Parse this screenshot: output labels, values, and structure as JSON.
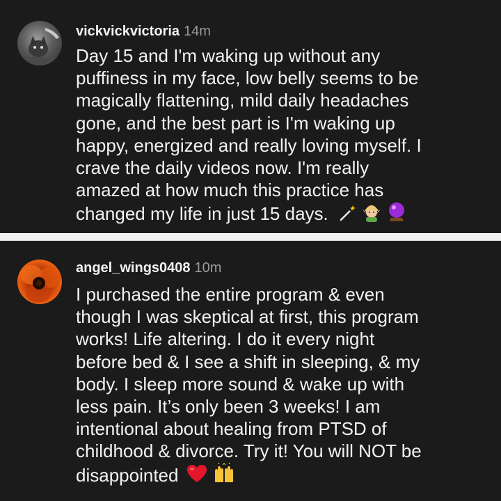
{
  "comments": [
    {
      "username": "vickvickvictoria",
      "time": "14m",
      "lines": [
        "Day 15 and I'm waking up without any",
        "puffiness in my face, low belly seems to be",
        "magically flattening, mild daily headaches",
        "gone, and the best part is I'm waking up",
        "happy, energized and really loving myself. I",
        "crave the daily videos now. I'm really",
        "amazed at how much this practice has",
        "changed my life in just 15 days."
      ],
      "emoji_icons": [
        "magic-wand-icon",
        "elf-icon",
        "crystal-ball-icon"
      ]
    },
    {
      "username": "angel_wings0408",
      "time": "10m",
      "lines": [
        "I purchased the entire program & even",
        "though I was skeptical at first, this program",
        "works!  Life altering. I do it every night",
        "before bed & I see a shift in sleeping, & my",
        "body. I sleep more sound & wake up with",
        "less pain. It’s only been 3 weeks! I am",
        "intentional about healing from PTSD of",
        "childhood & divorce. Try it! You will NOT be",
        "disappointed"
      ],
      "emoji_icons": [
        "red-heart-icon",
        "raising-hands-icon"
      ]
    }
  ]
}
